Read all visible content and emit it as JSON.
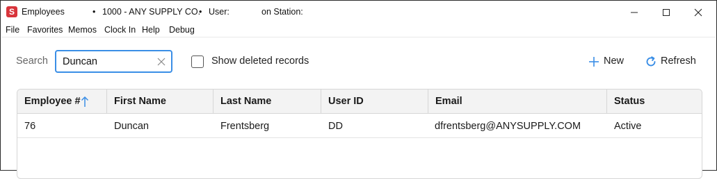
{
  "window": {
    "app_name": "Employees",
    "bullet": "•",
    "company": "1000 - ANY SUPPLY CO.",
    "user_label": "User:",
    "station_label": "on Station:",
    "logo_letter": "S",
    "logo_color": "#d8343b"
  },
  "menu": {
    "items": [
      "File",
      "Favorites",
      "Memos",
      "Clock In",
      "Help",
      "Debug"
    ]
  },
  "toolbar": {
    "search_label": "Search",
    "search_value": "Duncan",
    "show_deleted_label": "Show deleted records",
    "show_deleted_checked": false,
    "new_label": "New",
    "refresh_label": "Refresh",
    "accent_color": "#3a8ee6"
  },
  "grid": {
    "columns": [
      "Employee #",
      "First Name",
      "Last Name",
      "User ID",
      "Email",
      "Status"
    ],
    "sort_column": "Employee #",
    "sort_direction": "ascending",
    "rows": [
      {
        "employee_no": "76",
        "first_name": "Duncan",
        "last_name": "Frentsberg",
        "user_id": "DD",
        "email": "dfrentsberg@ANYSUPPLY.COM",
        "status": "Active"
      }
    ]
  }
}
